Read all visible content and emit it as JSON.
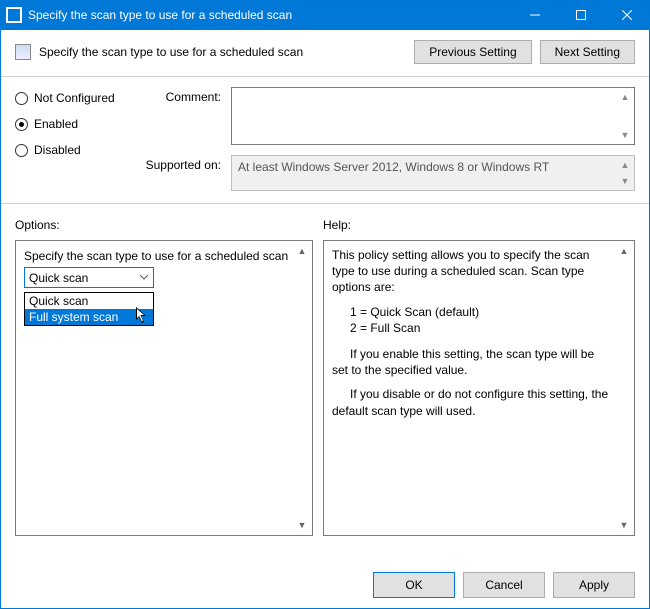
{
  "window": {
    "title": "Specify the scan type to use for a scheduled scan"
  },
  "header": {
    "text": "Specify the scan type to use for a scheduled scan",
    "previous_btn": "Previous Setting",
    "next_btn": "Next Setting"
  },
  "state": {
    "not_configured": "Not Configured",
    "enabled": "Enabled",
    "disabled": "Disabled",
    "selected": "Enabled"
  },
  "fields": {
    "comment_label": "Comment:",
    "comment_value": "",
    "supported_label": "Supported on:",
    "supported_value": "At least Windows Server 2012, Windows 8 or Windows RT"
  },
  "sections": {
    "options_label": "Options:",
    "help_label": "Help:"
  },
  "options_panel": {
    "setting_label": "Specify the scan type to use for a scheduled scan",
    "combo_selected": "Quick scan",
    "combo_options": [
      "Quick scan",
      "Full system scan"
    ],
    "combo_highlight_index": 1
  },
  "help_panel": {
    "p1": "This policy setting allows you to specify the scan type to use during a scheduled scan. Scan type options are:",
    "li1": "1 = Quick Scan (default)",
    "li2": "2 = Full Scan",
    "p2": "If you enable this setting, the scan type will be set to the specified value.",
    "p3": "If you disable or do not configure this setting, the default scan type will used."
  },
  "buttons": {
    "ok": "OK",
    "cancel": "Cancel",
    "apply": "Apply"
  }
}
